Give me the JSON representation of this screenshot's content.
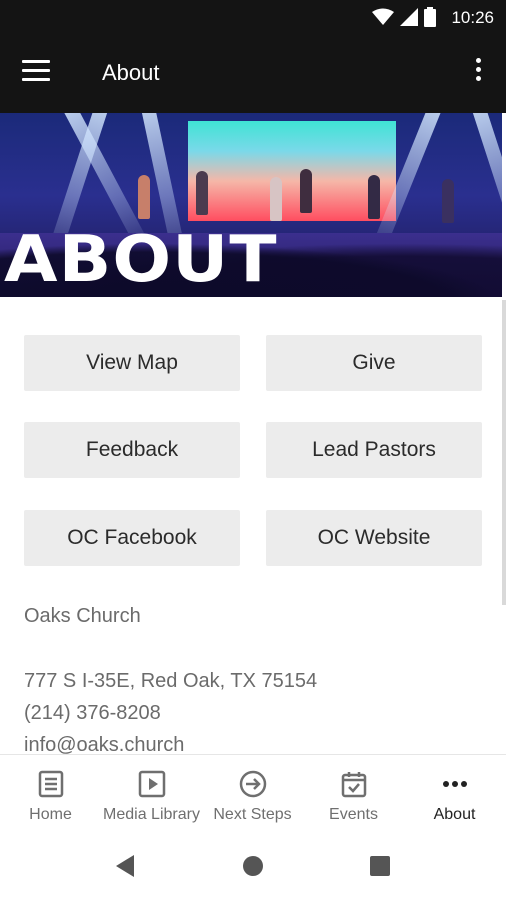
{
  "status_bar": {
    "time": "10:26"
  },
  "app_bar": {
    "title": "About"
  },
  "hero": {
    "overlay_text": "ABOUT"
  },
  "buttons": [
    {
      "label": "View Map"
    },
    {
      "label": "Give"
    },
    {
      "label": "Feedback"
    },
    {
      "label": "Lead Pastors"
    },
    {
      "label": "OC Facebook"
    },
    {
      "label": "OC Website"
    }
  ],
  "info": {
    "name": "Oaks Church",
    "address": "777 S I-35E, Red Oak, TX 75154",
    "phone": "(214) 376-8208",
    "email": "info@oaks.church"
  },
  "bottom_nav": [
    {
      "label": "Home",
      "icon": "home-icon"
    },
    {
      "label": "Media Library",
      "icon": "media-library-icon"
    },
    {
      "label": "Next Steps",
      "icon": "next-steps-icon"
    },
    {
      "label": "Events",
      "icon": "events-icon"
    },
    {
      "label": "About",
      "icon": "more-dots-icon",
      "active": true
    }
  ],
  "colors": {
    "bar": "#141414",
    "button_bg": "#ececec",
    "text_muted": "#6b6b6b"
  }
}
